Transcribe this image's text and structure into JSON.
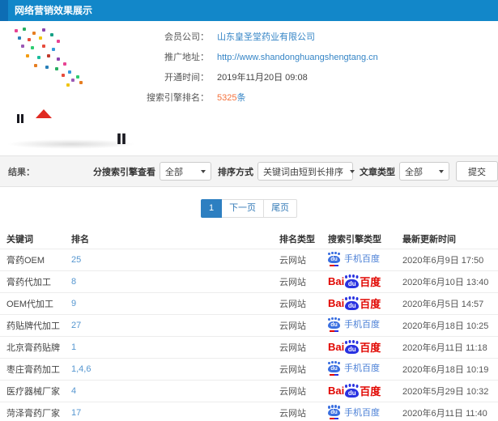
{
  "header": {
    "title": "网络营销效果展示",
    "bg_color": "#1287c9"
  },
  "info": {
    "rows": [
      {
        "label": "会员公司：",
        "value": "山东皇圣堂药业有限公司"
      },
      {
        "label": "推广地址：",
        "value": "http://www.shandonghuangshengtang.cn"
      },
      {
        "label": "开通时间：",
        "value": "2019年11月20日 09:08"
      },
      {
        "label": "搜索引擎排名：",
        "value": "5325",
        "suffix": "条"
      }
    ],
    "highlight_color": "#f4713c",
    "link_color": "#3585c6"
  },
  "filters": {
    "result_label": "结果：",
    "engine_label": "分搜索引擎查看",
    "engine_value": "全部",
    "sort_label": "排序方式",
    "sort_value": "关键词由短到长排序",
    "article_label": "文章类型",
    "article_value": "全部",
    "submit_label": "提交"
  },
  "pagination": {
    "current": "1",
    "next_label": "下一页",
    "last_label": "尾页"
  },
  "table": {
    "headers": [
      "关键词",
      "排名",
      "排名类型",
      "搜索引擎类型",
      "最新更新时间"
    ],
    "rows": [
      {
        "keyword": "膏药OEM",
        "rank": "25",
        "rank_type": "云网站",
        "engine": "mobile-baidu",
        "engine_label": "手机百度",
        "updated": "2020年6月9日 17:50"
      },
      {
        "keyword": "膏药代加工",
        "rank": "8",
        "rank_type": "云网站",
        "engine": "baidu",
        "engine_label": "百度",
        "updated": "2020年6月10日 13:40"
      },
      {
        "keyword": "OEM代加工",
        "rank": "9",
        "rank_type": "云网站",
        "engine": "baidu",
        "engine_label": "百度",
        "updated": "2020年6月5日 14:57"
      },
      {
        "keyword": "药贴牌代加工",
        "rank": "27",
        "rank_type": "云网站",
        "engine": "mobile-baidu",
        "engine_label": "手机百度",
        "updated": "2020年6月18日 10:25"
      },
      {
        "keyword": "北京膏药贴牌",
        "rank": "1",
        "rank_type": "云网站",
        "engine": "baidu",
        "engine_label": "百度",
        "updated": "2020年6月11日 11:18"
      },
      {
        "keyword": "枣庄膏药加工",
        "rank": "1,4,6",
        "rank_type": "云网站",
        "engine": "mobile-baidu",
        "engine_label": "手机百度",
        "updated": "2020年6月18日 10:19"
      },
      {
        "keyword": "医疗器械厂家",
        "rank": "4",
        "rank_type": "云网站",
        "engine": "baidu",
        "engine_label": "百度",
        "updated": "2020年5月29日 10:32"
      },
      {
        "keyword": "菏泽膏药厂家",
        "rank": "17",
        "rank_type": "云网站",
        "engine": "mobile-baidu",
        "engine_label": "手机百度",
        "updated": "2020年6月11日 11:40"
      }
    ]
  },
  "logos": {
    "baidu_bai": "Bai",
    "baidu_du": "du",
    "baidu_red": "#e10601",
    "baidu_blue": "#2932e1",
    "mobile_text_color": "#4a7fd6"
  }
}
